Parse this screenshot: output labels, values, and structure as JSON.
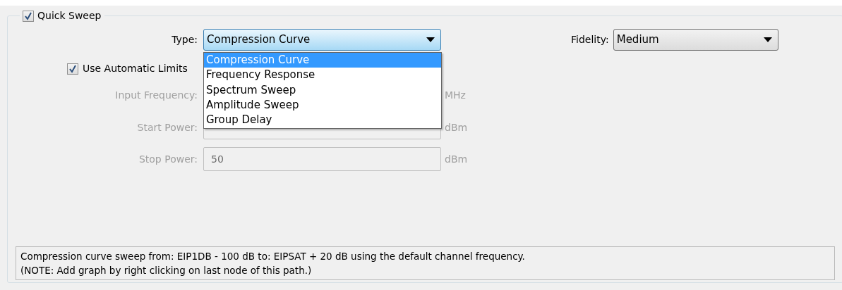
{
  "quick_sweep": {
    "label": "Quick Sweep",
    "checked": true
  },
  "type": {
    "label": "Type:",
    "value": "Compression Curve",
    "expanded": true,
    "options": [
      {
        "label": "Compression Curve",
        "selected": true
      },
      {
        "label": "Frequency Response",
        "selected": false
      },
      {
        "label": "Spectrum Sweep",
        "selected": false
      },
      {
        "label": "Amplitude Sweep",
        "selected": false
      },
      {
        "label": "Group Delay",
        "selected": false
      }
    ]
  },
  "fidelity": {
    "label": "Fidelity:",
    "value": "Medium"
  },
  "use_automatic_limits": {
    "label": "Use Automatic Limits",
    "checked": true
  },
  "fields": [
    {
      "label": "Input Frequency:",
      "unit": "MHz",
      "disabled": true,
      "covered": true
    },
    {
      "label": "Start Power:",
      "unit": "dBm",
      "disabled": true
    },
    {
      "label": "Stop Power:",
      "value": "50",
      "unit": "dBm",
      "disabled": true
    }
  ],
  "description": [
    "Compression curve sweep from: EIP1DB - 100 dB to: EIPSAT + 20 dB using the default channel frequency.",
    "(NOTE: Add graph by right clicking on last node of this path.)"
  ]
}
